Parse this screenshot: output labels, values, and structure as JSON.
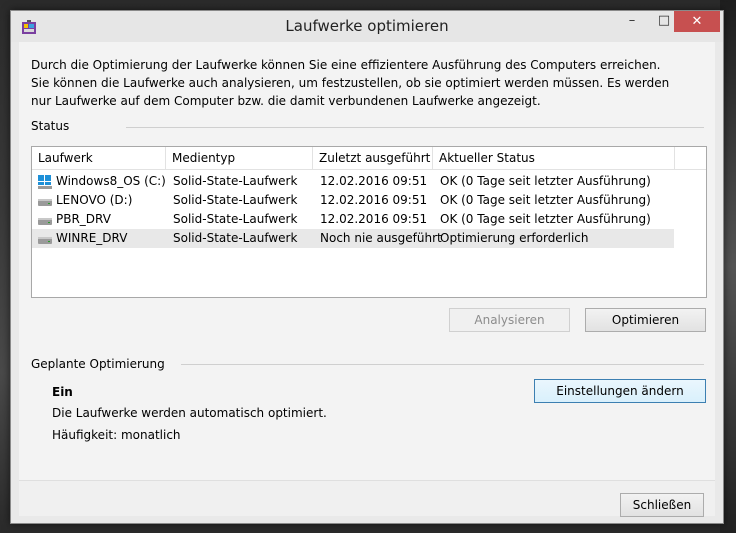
{
  "window": {
    "title": "Laufwerke optimieren",
    "minimize_glyph": "–",
    "maximize_glyph": "□",
    "close_glyph": "✕"
  },
  "description": "Durch die Optimierung der Laufwerke können Sie eine effizientere Ausführung des Computers erreichen. Sie können die Laufwerke auch analysieren, um festzustellen, ob sie optimiert werden müssen. Es werden nur Laufwerke auf dem Computer bzw. die damit verbundenen Laufwerke angezeigt.",
  "status": {
    "label": "Status",
    "columns": [
      "Laufwerk",
      "Medientyp",
      "Zuletzt ausgeführt",
      "Aktueller Status"
    ],
    "rows": [
      {
        "drive": "Windows8_OS (C:)",
        "media": "Solid-State-Laufwerk",
        "last_run": "12.02.2016 09:51",
        "state": "OK (0 Tage seit letzter Ausführung)",
        "icon": "windows-drive-icon"
      },
      {
        "drive": "LENOVO (D:)",
        "media": "Solid-State-Laufwerk",
        "last_run": "12.02.2016 09:51",
        "state": "OK (0 Tage seit letzter Ausführung)",
        "icon": "drive-icon"
      },
      {
        "drive": "PBR_DRV",
        "media": "Solid-State-Laufwerk",
        "last_run": "12.02.2016 09:51",
        "state": "OK (0 Tage seit letzter Ausführung)",
        "icon": "drive-icon"
      },
      {
        "drive": "WINRE_DRV",
        "media": "Solid-State-Laufwerk",
        "last_run": "Noch nie ausgeführt",
        "state": "Optimierung erforderlich",
        "icon": "drive-icon"
      }
    ],
    "analyze_label": "Analysieren",
    "optimize_label": "Optimieren"
  },
  "scheduled": {
    "label": "Geplante Optimierung",
    "state": "Ein",
    "info": "Die Laufwerke werden automatisch optimiert.",
    "frequency": "Häufigkeit: monatlich",
    "change_settings_label": "Einstellungen ändern"
  },
  "close_label": "Schließen",
  "colors": {
    "close_button": "#c75050",
    "selected_row": "#e8e8e8",
    "window_bg": "#f3f3f3"
  }
}
